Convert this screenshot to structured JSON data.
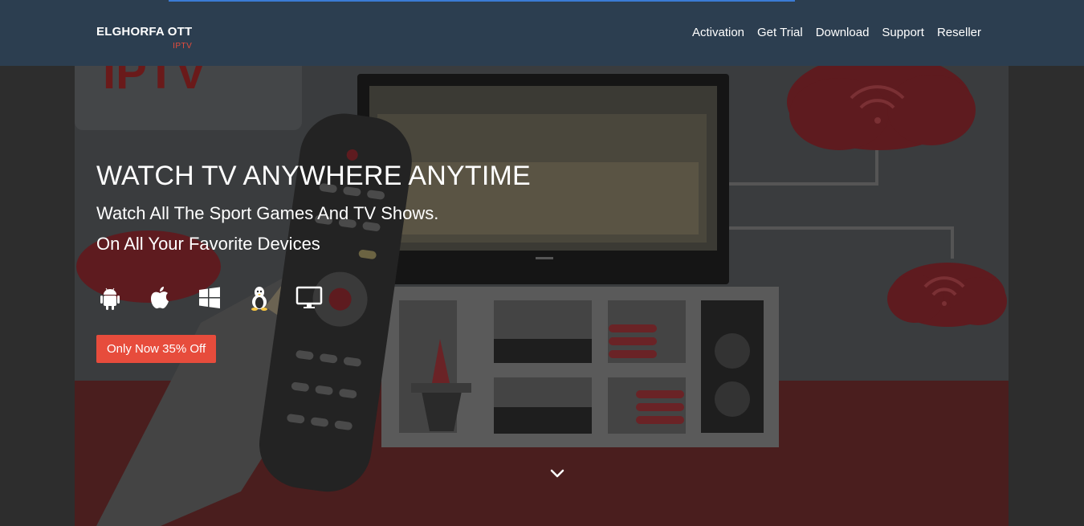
{
  "header": {
    "brand": {
      "name": "ELGHORFA OTT",
      "sub": "IPTV"
    },
    "nav": [
      {
        "label": "Activation"
      },
      {
        "label": "Get Trial"
      },
      {
        "label": "Download"
      },
      {
        "label": "Support"
      },
      {
        "label": "Reseller"
      }
    ]
  },
  "hero": {
    "bg_sign_text": "IPTV",
    "title": "WATCH TV ANYWHERE ANYTIME",
    "line1": "Watch All The Sport Games And TV Shows.",
    "line2": "On All Your Favorite Devices",
    "devices": [
      "android-icon",
      "apple-icon",
      "windows-icon",
      "linux-icon",
      "monitor-icon"
    ],
    "cta": "Only Now 35% Off",
    "scroll_icon": "chevron-down-icon"
  },
  "colors": {
    "header_bg": "#2c3e50",
    "accent": "#e74c3c",
    "text": "#ffffff"
  }
}
